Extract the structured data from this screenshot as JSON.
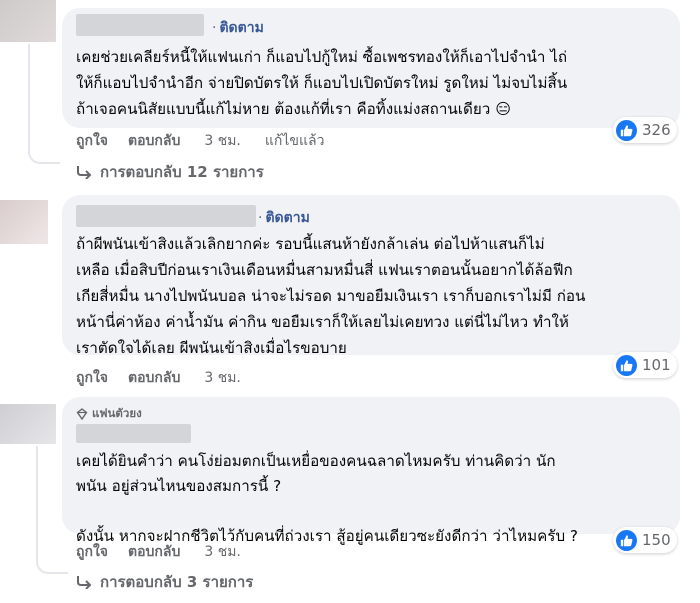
{
  "comments": [
    {
      "follow_label": "ติดตาม",
      "text": "เคยช่วยเคลียร์หนี้ให้แฟนเก่า ก็แอบไปกู้ใหม่ ซื้อเพชรทองให้ก็เอาไปจำนำ ไถ่\nให้ก็แอบไปจำนำอีก จ่ายปิดบัตรให้ ก็แอบไปเปิดบัตรใหม่ รูดใหม่ ไม่จบไม่สิ้น\nถ้าเจอคนนิสัยแบบนี้แก้ไม่หาย ต้องแก้ที่เรา คือทิ้งแม่งสถานเดียว 😑",
      "reaction_count": "326",
      "like_label": "ถูกใจ",
      "reply_label": "ตอบกลับ",
      "time": "3 ชม.",
      "edited": "แก้ไขแล้ว",
      "replies_label": "การตอบกลับ 12 รายการ"
    },
    {
      "follow_label": "ติดตาม",
      "text": "ถ้าผีพนันเข้าสิงแล้วเลิกยากค่ะ รอบนี้แสนห้ายังกล้าเล่น ต่อไปห้าแสนก็ไม่\nเหลือ เมื่อสิบปีก่อนเราเงินเดือนหมื่นสามหมื่นสี่ แฟนเราตอนนั้นอยากได้ล้อฟีก\nเกียสี่หมื่น นางไปพนันบอล น่าจะไม่รอด มาขอยืมเงินเรา เราก็บอกเราไม่มี ก่อน\nหน้านี่ค่าห้อง ค่าน้ำมัน ค่ากิน ขอยืมเราก็ให้เลยไม่เคยทวง แต่นี่ไม่ไหว ทำให้\nเราตัดใจได้เลย ผีพนันเข้าสิงเมื่อไรขอบาย",
      "reaction_count": "101",
      "like_label": "ถูกใจ",
      "reply_label": "ตอบกลับ",
      "time": "3 ชม."
    },
    {
      "badge": "แฟนตัวยง",
      "text": "เคยได้ยินคำว่า คนโง่ย่อมตกเป็นเหยื่อของคนฉลาดไหมครับ ท่านคิดว่า นัก\nพนัน อยู่ส่วนไหนของสมการนี้ ?\n\nดังนั้น หากจะฝากชีวิตไว้กับคนที่ถ่วงเรา สู้อยู่คนเดียวซะยังดีกว่า ว่าไหมครับ ?",
      "reaction_count": "150",
      "like_label": "ถูกใจ",
      "reply_label": "ตอบกลับ",
      "time": "3 ชม.",
      "replies_label": "การตอบกลับ 3 รายการ"
    }
  ],
  "colors": {
    "bubble": "#f0f2f5",
    "link": "#385898",
    "secondary_text": "#65676b",
    "like_blue": "#1877f2"
  },
  "icons": [
    "like-icon",
    "reply-arrow-icon",
    "fan-badge-icon"
  ]
}
